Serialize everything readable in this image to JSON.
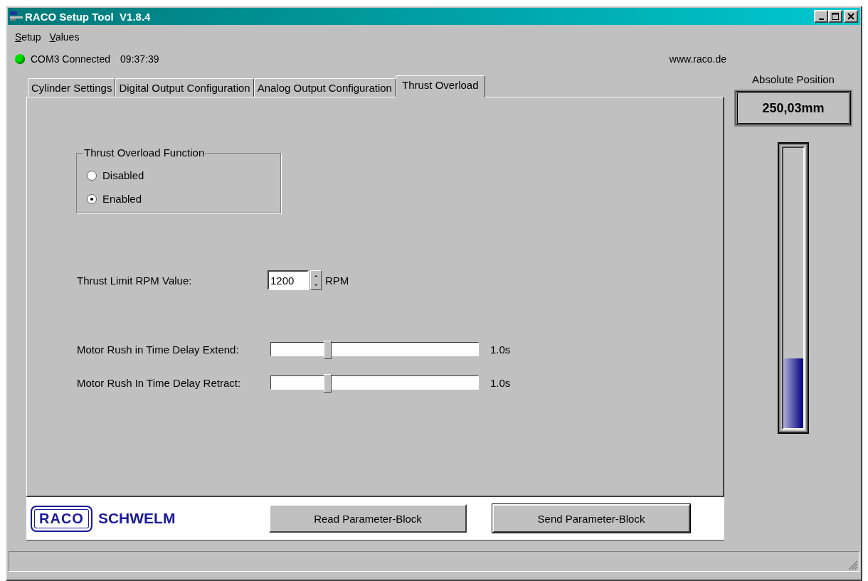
{
  "window": {
    "title": "RACO Setup Tool  V1.8.4"
  },
  "menu": [
    {
      "label": "Setup"
    },
    {
      "label": "Values"
    }
  ],
  "connection": {
    "connected": true,
    "port_status": "COM3 Connected",
    "time": "09:37:39",
    "website": "www.raco.de"
  },
  "tabs": [
    {
      "label": "Cylinder Settings",
      "selected": false
    },
    {
      "label": "Digital Output Configuration",
      "selected": false
    },
    {
      "label": "Analog Output Configuration",
      "selected": false
    },
    {
      "label": "Thrust Overload",
      "selected": true
    }
  ],
  "thrust_overload": {
    "group_title": "Thrust Overload Function",
    "options": [
      {
        "label": "Disabled",
        "selected": false
      },
      {
        "label": "Enabled",
        "selected": true
      }
    ],
    "rpm_label": "Thrust Limit RPM Value:",
    "rpm_value": "1200",
    "rpm_unit": "RPM",
    "sliders": [
      {
        "label": "Motor Rush in Time Delay Extend:",
        "level": 0.27,
        "reading": "1.0s"
      },
      {
        "label": "Motor Rush In Time Delay Retract:",
        "level": 0.27,
        "reading": "1.0s"
      }
    ]
  },
  "footer": {
    "logo_box": "RACO",
    "logo_text": "SCHWELM",
    "buttons": [
      {
        "label": "Read Parameter-Block",
        "focused": false
      },
      {
        "label": "Send Parameter-Block",
        "focused": true
      }
    ]
  },
  "position": {
    "title": "Absolute Position",
    "value": "250,03mm",
    "level": 0.25
  }
}
